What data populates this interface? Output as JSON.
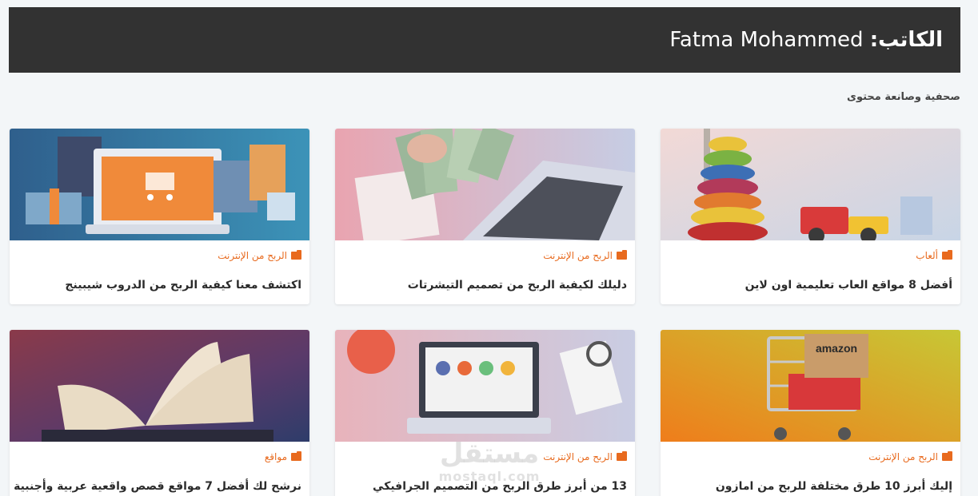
{
  "header": {
    "label": "الكاتب:",
    "author": "Fatma Mohammed"
  },
  "bio": "صحفية وصانعة محتوى",
  "cards": [
    {
      "category": "ألعاب",
      "title": "أفضل 8 مواقع العاب تعليمية اون لاين",
      "image": "toys"
    },
    {
      "category": "الربح من الإنترنت",
      "title": "دليلك لكيفية الربح من تصميم التيشرتات",
      "image": "money-laptop"
    },
    {
      "category": "الربح من الإنترنت",
      "title": "اكتشف معنا كيفية الربح من الدروب شيبينج",
      "image": "shopping-laptop"
    },
    {
      "category": "الربح من الإنترنت",
      "title": "إليك أبرز 10 طرق مختلفة للربح من امازون",
      "image": "amazon-cart",
      "image_text": "amazon"
    },
    {
      "category": "الربح من الإنترنت",
      "title": "13 من أبرز طرق الربح من التصميم الجرافيكي",
      "image": "design-desk"
    },
    {
      "category": "مواقع",
      "title": "نرشح لك أفضل 7 مواقع قصص واقعية عربية وأجنبية",
      "image": "open-book"
    }
  ],
  "watermark": {
    "arabic": "مستقل",
    "latin": "mostaql.com"
  }
}
